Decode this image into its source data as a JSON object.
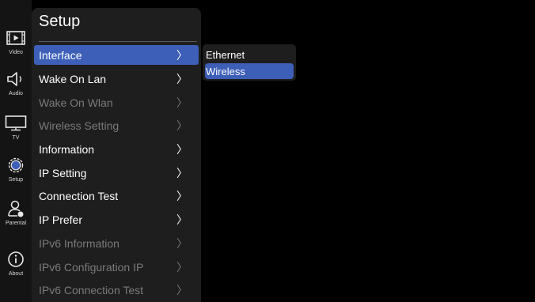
{
  "colors": {
    "accent": "#3d5fb8",
    "panel_bg": "#1e1e1e",
    "disabled_text": "#7a7a7a"
  },
  "rail": {
    "items": [
      {
        "label": "Video",
        "icon": "video-icon"
      },
      {
        "label": "Audio",
        "icon": "speaker-icon"
      },
      {
        "label": "TV",
        "icon": "tv-icon"
      },
      {
        "label": "Setup",
        "icon": "gear-icon"
      },
      {
        "label": "Parental",
        "icon": "parental-lock-icon"
      },
      {
        "label": "About",
        "icon": "info-icon"
      }
    ]
  },
  "menu": {
    "title": "Setup",
    "items": [
      {
        "label": "Interface",
        "chevron": "〉",
        "state": "selected"
      },
      {
        "label": "Wake On Lan",
        "chevron": "〉",
        "state": "enabled"
      },
      {
        "label": "Wake On Wlan",
        "chevron": "〉",
        "state": "disabled"
      },
      {
        "label": "Wireless Setting",
        "chevron": "〉",
        "state": "disabled"
      },
      {
        "label": "Information",
        "chevron": "〉",
        "state": "enabled"
      },
      {
        "label": "IP Setting",
        "chevron": "〉",
        "state": "enabled"
      },
      {
        "label": "Connection Test",
        "chevron": "〉",
        "state": "enabled"
      },
      {
        "label": "IP Prefer",
        "chevron": "〉",
        "state": "enabled"
      },
      {
        "label": "IPv6 Information",
        "chevron": "〉",
        "state": "disabled"
      },
      {
        "label": "IPv6 Configuration IP",
        "chevron": "〉",
        "state": "disabled"
      },
      {
        "label": "IPv6 Connection Test",
        "chevron": "〉",
        "state": "disabled"
      }
    ]
  },
  "submenu": {
    "options": [
      {
        "label": "Ethernet",
        "state": "enabled"
      },
      {
        "label": "Wireless",
        "state": "selected"
      }
    ]
  }
}
